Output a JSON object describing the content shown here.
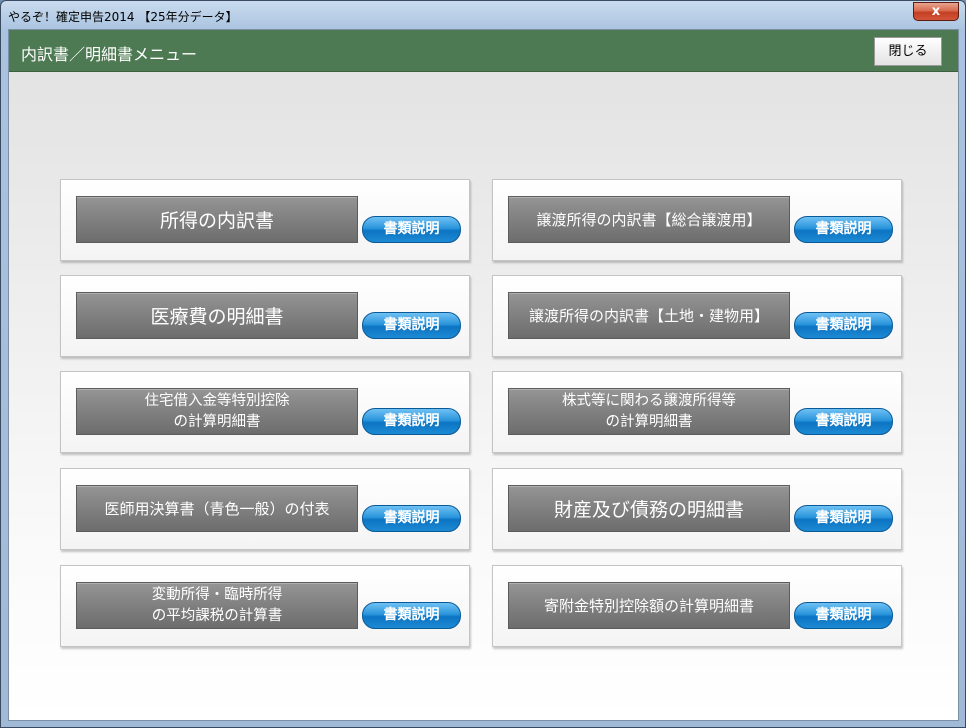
{
  "window": {
    "title": "やるぞ！確定申告2014 【25年分データ】",
    "close_symbol": "x"
  },
  "header": {
    "title": "内訳書／明細書メニュー",
    "close_button": "閉じる"
  },
  "info_label": "書類説明",
  "cards": [
    {
      "lines": [
        "所得の内訳書"
      ]
    },
    {
      "lines": [
        "譲渡所得の内訳書【総合譲渡用】"
      ]
    },
    {
      "lines": [
        "医療費の明細書"
      ]
    },
    {
      "lines": [
        "譲渡所得の内訳書【土地・建物用】"
      ]
    },
    {
      "lines": [
        "住宅借入金等特別控除",
        "の計算明細書"
      ]
    },
    {
      "lines": [
        "株式等に関わる譲渡所得等",
        "の計算明細書"
      ]
    },
    {
      "lines": [
        "医師用決算書（青色一般）の付表"
      ]
    },
    {
      "lines": [
        "財産及び債務の明細書"
      ]
    },
    {
      "lines": [
        "変動所得・臨時所得",
        "の平均課税の計算書"
      ]
    },
    {
      "lines": [
        "寄附金特別控除額の計算明細書"
      ]
    }
  ]
}
